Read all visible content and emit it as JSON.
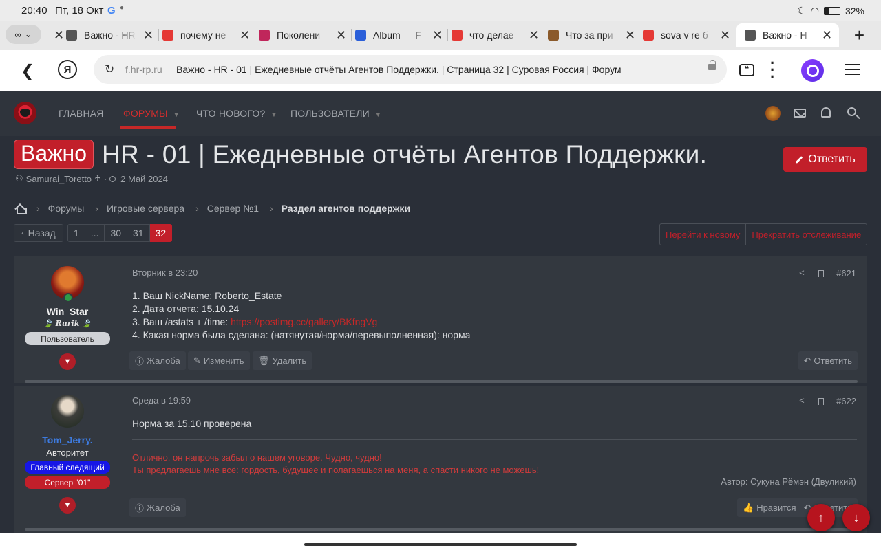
{
  "status_bar": {
    "time": "20:40",
    "date": "Пт, 18 Окт",
    "battery": "32%",
    "battery_level": 0.32
  },
  "tabs": [
    {
      "title": "Важно - HR",
      "favicon": "forum-icon",
      "color": "#555555"
    },
    {
      "title": "почему не",
      "favicon": "yandex-icon",
      "color": "#e53935"
    },
    {
      "title": "Поколени",
      "favicon": "lio-icon",
      "color": "#c0265b"
    },
    {
      "title": "Album — F",
      "favicon": "postimg-icon",
      "color": "#2b5fd9"
    },
    {
      "title": "что делае",
      "favicon": "yandex-icon",
      "color": "#e53935"
    },
    {
      "title": "Что за при",
      "favicon": "ms-icon",
      "color": "#8b5a2b"
    },
    {
      "title": "sova v re б",
      "favicon": "yandex-icon",
      "color": "#e53935"
    },
    {
      "title": "Важно - H",
      "favicon": "forum-icon",
      "color": "#555555",
      "active": true
    }
  ],
  "address_bar": {
    "domain": "f.hr-rp.ru",
    "page_title": "Важно - HR - 01 | Ежедневные отчёты Агентов Поддержки. | Страница 32 | Суровая Россия | Форум",
    "logo": "Я"
  },
  "forum_nav": {
    "items": [
      "ГЛАВНАЯ",
      "ФОРУМЫ",
      "ЧТО НОВОГО?",
      "ПОЛЬЗОВАТЕЛИ"
    ],
    "accent": "#c62828"
  },
  "thread": {
    "badge": "Важно",
    "title": "HR - 01 | Ежедневные отчёты Агентов Поддержки.",
    "reply_label": "Ответить",
    "author": "Samurai_Toretto",
    "author_suffix": "♰",
    "date": "2 Май 2024"
  },
  "breadcrumbs": [
    "Форумы",
    "Игровые сервера",
    "Сервер №1",
    "Раздел агентов поддержки"
  ],
  "pagination": {
    "back": "Назад",
    "pages": [
      "1",
      "...",
      "30",
      "31",
      "32"
    ],
    "current": "32",
    "goto_new": "Перейти к новому",
    "unwatch": "Прекратить отслеживание"
  },
  "posts": [
    {
      "user": "Win_Star",
      "user_subtitle": "🍃 Rurik 🍃",
      "role": "Пользователь",
      "time": "Вторник в 23:20",
      "number": "#621",
      "lines": [
        "1. Ваш NickName: Roberto_Estate",
        "2. Дата отчета: 15.10.24",
        "3. Ваш /astats + /time: ",
        "4. Какая норма была сделана: (натянутая/норма/перевыполненная): норма"
      ],
      "link": "https://postimg.cc/gallery/BKfngVg",
      "actions": [
        "Жалоба",
        "Изменить",
        "Удалить"
      ],
      "reply": "Ответить"
    },
    {
      "user": "Tom_Jerry.",
      "user_title": "Авторитет",
      "badges": [
        "Главный следящий",
        "Сервер \"01\""
      ],
      "time": "Среда в 19:59",
      "number": "#622",
      "body": "Норма за 15.10 проверена",
      "quote_lines": [
        "Отлично, он напрочь забыл о нашем уговоре. Чудно, чудно!",
        "Ты предлагаешь мне всё: гордость, будущее и полагаешься на меня, а спасти никого не можешь!"
      ],
      "quote_author": "Автор: Сукуна Рёмэн (Двуликий)",
      "actions": [
        "Жалоба"
      ],
      "like": "Нравится",
      "reply": "Ответить"
    }
  ]
}
